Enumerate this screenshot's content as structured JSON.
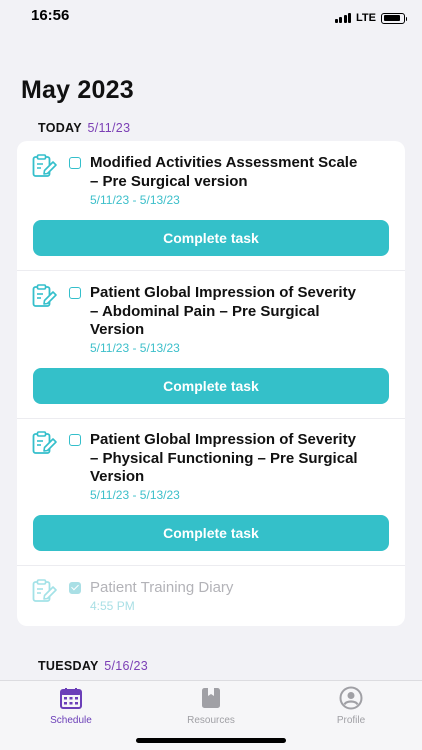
{
  "status": {
    "time": "16:56",
    "network": "LTE",
    "battery_level": 0.85
  },
  "schedule": {
    "month_title": "May 2023",
    "today": {
      "label": "TODAY",
      "date": "5/11/23"
    },
    "tasks": [
      {
        "title": "Modified Activities Assessment Scale – Pre Surgical version",
        "dates": "5/11/23 - 5/13/23",
        "button": "Complete task",
        "completed": false
      },
      {
        "title": "Patient Global Impression of Severity – Abdominal Pain – Pre Surgical Version",
        "dates": "5/11/23 - 5/13/23",
        "button": "Complete task",
        "completed": false
      },
      {
        "title": "Patient Global Impression of Severity – Physical Functioning – Pre Surgical Version",
        "dates": "5/11/23 - 5/13/23",
        "button": "Complete task",
        "completed": false
      },
      {
        "title": "Patient Training Diary",
        "dates": "4:55 PM",
        "completed": true
      }
    ],
    "next_day": {
      "label": "TUESDAY",
      "date": "5/16/23"
    }
  },
  "tabs": [
    {
      "label": "Schedule",
      "icon": "calendar-icon",
      "active": true
    },
    {
      "label": "Resources",
      "icon": "book-icon",
      "active": false
    },
    {
      "label": "Profile",
      "icon": "profile-icon",
      "active": false
    }
  ],
  "colors": {
    "accent": "#34c0c9",
    "purple": "#6b3fb8",
    "date_purple": "#7b3fb5"
  }
}
